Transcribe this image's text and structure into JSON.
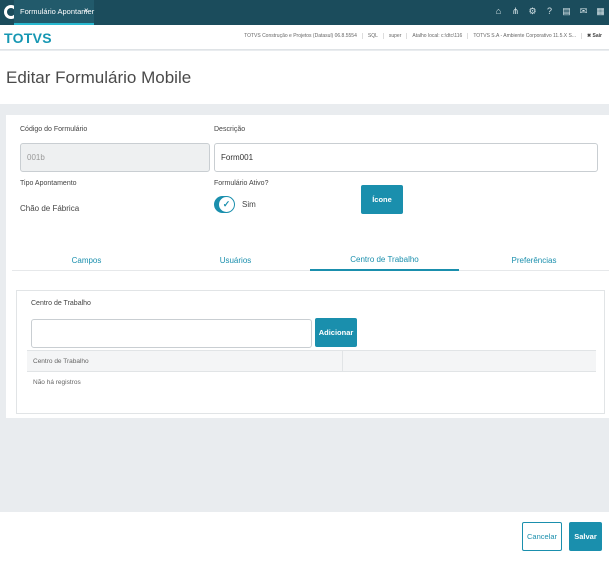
{
  "topbar": {
    "tab_label": "Formulário Apontamer",
    "tab_close": "×",
    "icons": [
      "home-icon",
      "sitemap-icon",
      "gear-icon",
      "help-icon",
      "document-icon",
      "mail-icon",
      "grid-icon"
    ]
  },
  "brandbar": {
    "brand": "TOTVS",
    "info": [
      "TOTVS Construção e Projetos (Datasul) 06.8.5554",
      "SQL",
      "super",
      "Atalho local: c:\\dtc\\116",
      "TOTVS S.A - Ambiente Corporativo 11.5.X S..."
    ],
    "exit_label": "✖ Sair"
  },
  "header": {
    "title": "Editar Formulário Mobile"
  },
  "form": {
    "code_label": "Código do Formulário",
    "code_value": "001b",
    "description_label": "Descrição",
    "description_value": "Form001",
    "type_label": "Tipo Apontamento",
    "type_value": "Chão de Fábrica",
    "active_label": "Formulário Ativo?",
    "active_value": "Sim",
    "icon_button": "Ícone"
  },
  "tabs": [
    {
      "label": "Campos",
      "active": false
    },
    {
      "label": "Usuários",
      "active": false
    },
    {
      "label": "Centro de Trabalho",
      "active": true
    },
    {
      "label": "Preferências",
      "active": false
    }
  ],
  "work_center": {
    "label": "Centro de Trabalho",
    "input_value": "",
    "add_button": "Adicionar",
    "grid_header": "Centro de Trabalho",
    "empty_text": "Não há registros"
  },
  "footer": {
    "cancel": "Cancelar",
    "save": "Salvar"
  },
  "colors": {
    "topbar": "#1b4c5c",
    "accent": "#1a8fad",
    "brand": "#1697b3"
  }
}
